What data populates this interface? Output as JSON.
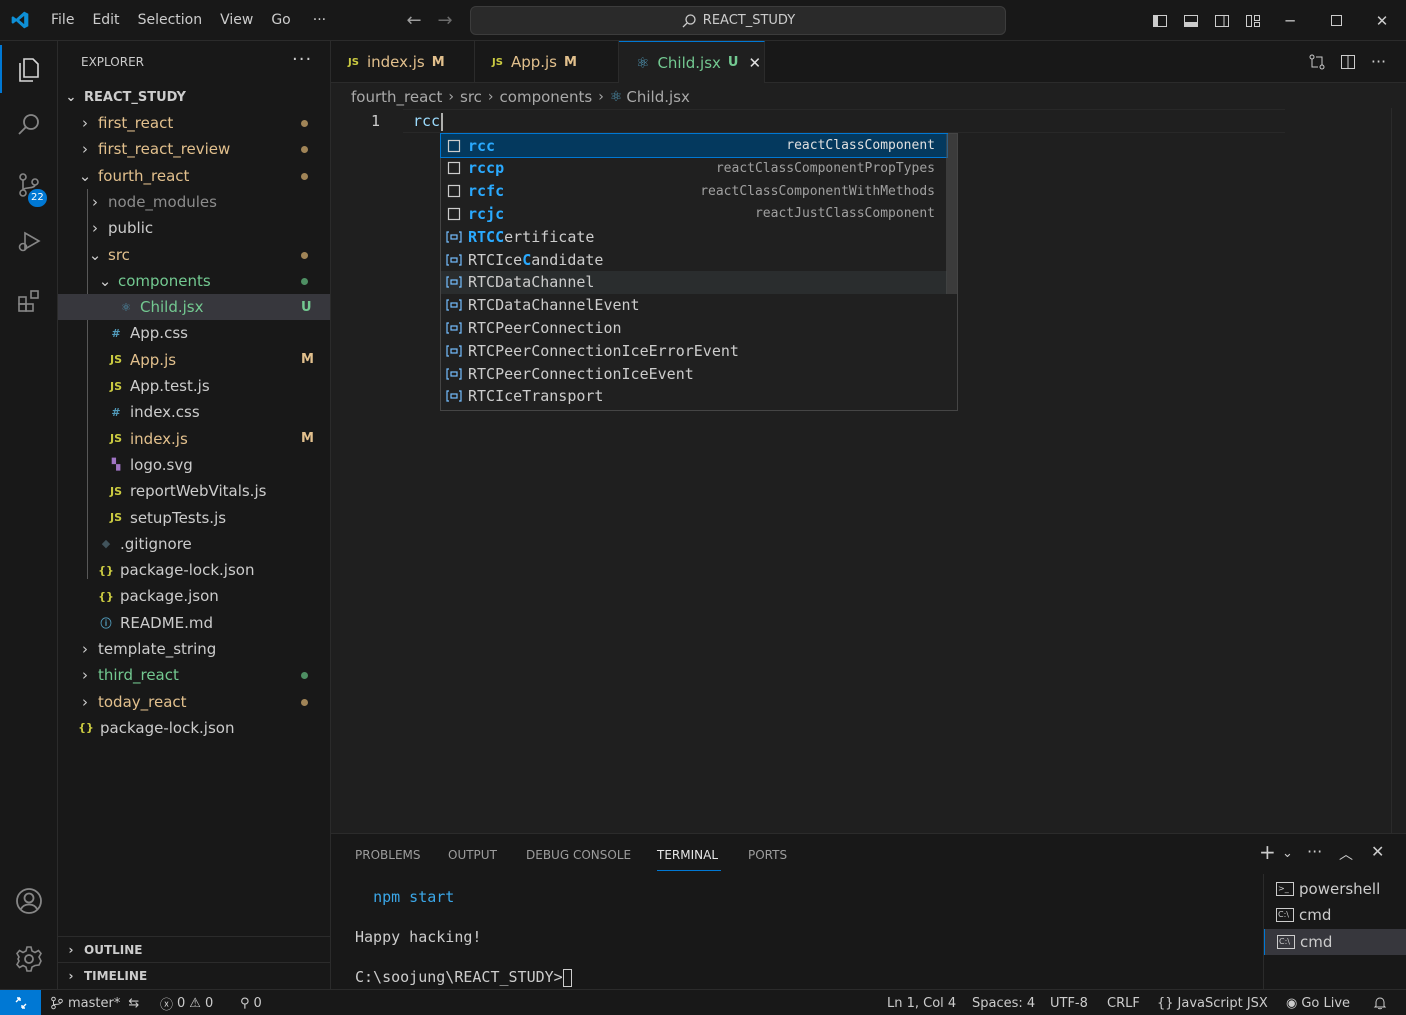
{
  "titlebar": {
    "menu": [
      "File",
      "Edit",
      "Selection",
      "View",
      "Go"
    ],
    "more": "···",
    "search_text": "REACT_STUDY"
  },
  "activitybar": {
    "scm_badge": "22"
  },
  "sidebar": {
    "title": "EXPLORER",
    "more": "···",
    "root": "REACT_STUDY",
    "items": [
      {
        "label": "first_react",
        "color": "#e2c08d",
        "status": "dot",
        "status_color": "#a08457"
      },
      {
        "label": "first_react_review",
        "color": "#e2c08d",
        "status": "dot",
        "status_color": "#a08457"
      },
      {
        "label": "fourth_react",
        "color": "#e2c08d",
        "status": "dot",
        "status_color": "#a08457"
      },
      {
        "label": "node_modules",
        "color": "#8c8c8c"
      },
      {
        "label": "public",
        "color": "#cccccc"
      },
      {
        "label": "src",
        "color": "#e2c08d",
        "status": "dot",
        "status_color": "#a08457"
      },
      {
        "label": "components",
        "color": "#73c991",
        "status": "dot",
        "status_color": "#4e8f63"
      },
      {
        "label": "Child.jsx",
        "color": "#73c991",
        "status": "U",
        "status_color": "#73c991"
      },
      {
        "label": "App.css",
        "color": "#cccccc"
      },
      {
        "label": "App.js",
        "color": "#e2c08d",
        "status": "M",
        "status_color": "#e2c08d"
      },
      {
        "label": "App.test.js",
        "color": "#cccccc"
      },
      {
        "label": "index.css",
        "color": "#cccccc"
      },
      {
        "label": "index.js",
        "color": "#e2c08d",
        "status": "M",
        "status_color": "#e2c08d"
      },
      {
        "label": "logo.svg",
        "color": "#cccccc"
      },
      {
        "label": "reportWebVitals.js",
        "color": "#cccccc"
      },
      {
        "label": "setupTests.js",
        "color": "#cccccc"
      },
      {
        "label": ".gitignore",
        "color": "#cccccc"
      },
      {
        "label": "package-lock.json",
        "color": "#cccccc"
      },
      {
        "label": "package.json",
        "color": "#cccccc"
      },
      {
        "label": "README.md",
        "color": "#cccccc"
      },
      {
        "label": "template_string",
        "color": "#cccccc"
      },
      {
        "label": "third_react",
        "color": "#73c991",
        "status": "dot",
        "status_color": "#4e8f63"
      },
      {
        "label": "today_react",
        "color": "#e2c08d",
        "status": "dot",
        "status_color": "#a08457"
      },
      {
        "label": "package-lock.json",
        "color": "#cccccc"
      }
    ],
    "outline": "OUTLINE",
    "timeline": "TIMELINE"
  },
  "tabs": [
    {
      "icon": "JS",
      "label": "index.js",
      "status": "M",
      "color": "#e2c08d"
    },
    {
      "icon": "JS",
      "label": "App.js",
      "status": "M",
      "color": "#e2c08d"
    },
    {
      "icon": "react",
      "label": "Child.jsx",
      "status": "U",
      "color": "#73c991"
    }
  ],
  "breadcrumb": [
    "fourth_react",
    "src",
    "components",
    "Child.jsx"
  ],
  "editor": {
    "line_number": "1",
    "code": "rcc"
  },
  "suggest": [
    {
      "kind": "snippet",
      "hl": "rcc",
      "rest": "",
      "detail": "reactClassComponent"
    },
    {
      "kind": "snippet",
      "hl": "rcc",
      "rest": "p",
      "detail": "reactClassComponentPropTypes"
    },
    {
      "kind": "snippet",
      "hl": "rc",
      "rest": "fc",
      "detail": "reactClassComponentWithMethods"
    },
    {
      "kind": "snippet",
      "hl": "rc",
      "rest": "jc",
      "detail": "reactJustClassComponent"
    },
    {
      "kind": "variable",
      "pre": "",
      "hl": "RTCC",
      "rest": "ertificate",
      "detail": ""
    },
    {
      "kind": "variable",
      "pre": "RTCIce",
      "hl": "C",
      "rest": "andidate",
      "detail": ""
    },
    {
      "kind": "variable",
      "pre": "RTCDataChannel",
      "hl": "",
      "rest": "",
      "detail": ""
    },
    {
      "kind": "variable",
      "pre": "RTCDataChannelEvent",
      "hl": "",
      "rest": "",
      "detail": ""
    },
    {
      "kind": "variable",
      "pre": "RTCPeerConnection",
      "hl": "",
      "rest": "",
      "detail": ""
    },
    {
      "kind": "variable",
      "pre": "RTCPeerConnectionIceErrorEvent",
      "hl": "",
      "rest": "",
      "detail": ""
    },
    {
      "kind": "variable",
      "pre": "RTCPeerConnectionIceEvent",
      "hl": "",
      "rest": "",
      "detail": ""
    },
    {
      "kind": "variable",
      "pre": "RTCIceTransport",
      "hl": "",
      "rest": "",
      "detail": ""
    }
  ],
  "panel": {
    "tabs": [
      "PROBLEMS",
      "OUTPUT",
      "DEBUG CONSOLE",
      "TERMINAL",
      "PORTS"
    ],
    "active_tab": "TERMINAL",
    "terminal_lines": [
      "npm start",
      "Happy hacking!",
      "C:\\soojung\\REACT_STUDY>"
    ],
    "terminals": [
      "powershell",
      "cmd",
      "cmd"
    ]
  },
  "statusbar": {
    "branch": "master*",
    "errors": "0",
    "warnings": "0",
    "ports": "0",
    "position": "Ln 1, Col 4",
    "spaces": "Spaces: 4",
    "encoding": "UTF-8",
    "eol": "CRLF",
    "language": "JavaScript JSX",
    "golive": "Go Live"
  },
  "colors": {
    "accent": "#0078d4",
    "modified": "#e2c08d",
    "untracked": "#73c991",
    "highlight": "#2aaaff"
  }
}
